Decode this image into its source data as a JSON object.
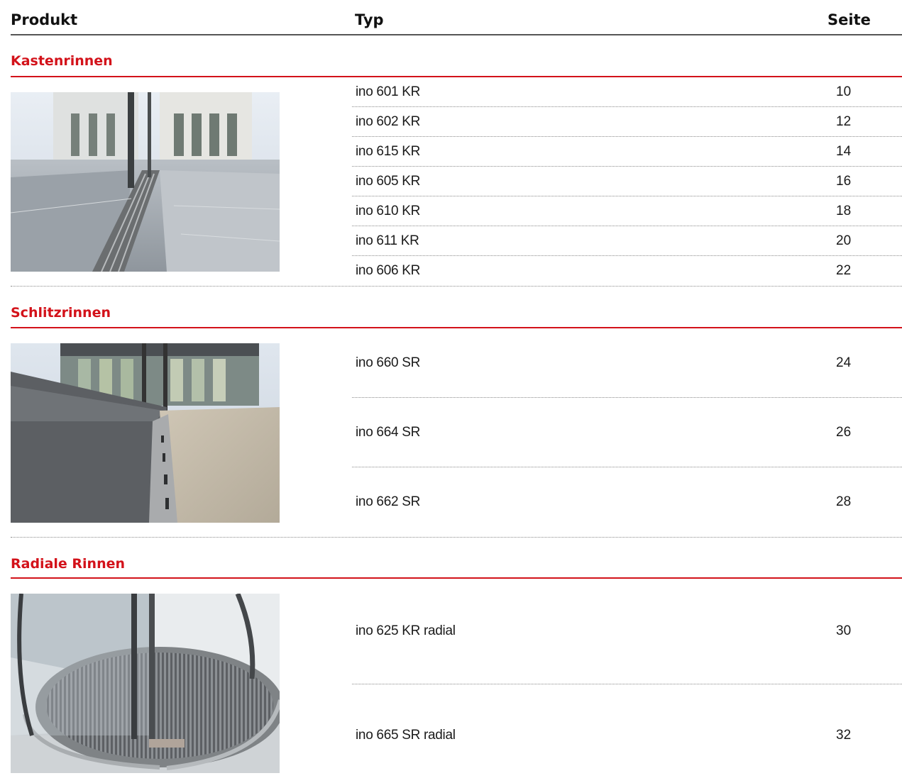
{
  "header": {
    "produkt": "Produkt",
    "typ": "Typ",
    "seite": "Seite"
  },
  "sections": [
    {
      "title": "Kastenrinnen",
      "items": [
        {
          "typ": "ino 601 KR",
          "seite": "10"
        },
        {
          "typ": "ino 602 KR",
          "seite": "12"
        },
        {
          "typ": "ino 615 KR",
          "seite": "14"
        },
        {
          "typ": "ino 605 KR",
          "seite": "16"
        },
        {
          "typ": "ino 610 KR",
          "seite": "18"
        },
        {
          "typ": "ino 611 KR",
          "seite": "20"
        },
        {
          "typ": "ino 606 KR",
          "seite": "22"
        }
      ]
    },
    {
      "title": "Schlitzrinnen",
      "items": [
        {
          "typ": "ino 660 SR",
          "seite": "24"
        },
        {
          "typ": "ino 664 SR",
          "seite": "26"
        },
        {
          "typ": "ino 662 SR",
          "seite": "28"
        }
      ]
    },
    {
      "title": "Radiale Rinnen",
      "items": [
        {
          "typ": "ino 625 KR radial",
          "seite": "30"
        },
        {
          "typ": "ino 665 SR radial",
          "seite": "32"
        }
      ]
    }
  ],
  "colors": {
    "accent": "#d3121a",
    "rule": "#555555",
    "dotted": "#8a8a8a"
  }
}
